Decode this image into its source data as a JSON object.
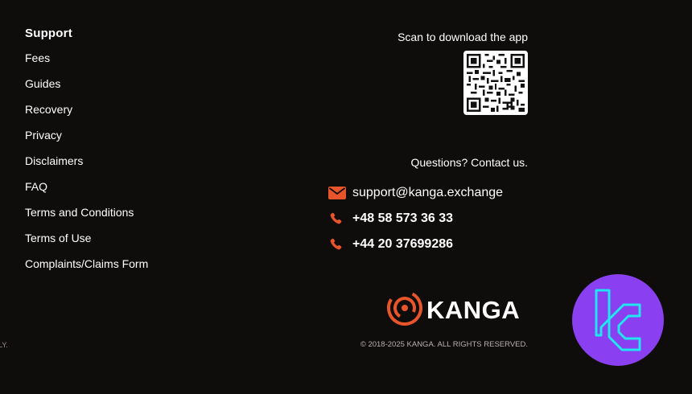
{
  "support": {
    "heading": "Support",
    "items": [
      {
        "label": "Fees"
      },
      {
        "label": "Guides"
      },
      {
        "label": "Recovery"
      },
      {
        "label": "Privacy"
      },
      {
        "label": "Disclaimers"
      },
      {
        "label": "FAQ"
      },
      {
        "label": "Terms and Conditions"
      },
      {
        "label": "Terms of Use"
      },
      {
        "label": "Complaints/Claims Form"
      }
    ]
  },
  "edge_fragment": "LY.",
  "app": {
    "scan_text": "Scan to download the app",
    "qr_icon": "qr-code-icon"
  },
  "contact": {
    "heading": "Questions? Contact us.",
    "email": "support@kanga.exchange",
    "phone_1": "+48 58 573 36 33",
    "phone_2": "+44 20 37699286",
    "email_icon": "envelope-icon",
    "phone_icon": "phone-icon"
  },
  "brand": {
    "name": "KANGA",
    "copyright": "© 2018-2025 KANGA. ALL RIGHTS RESERVED.",
    "logo_icon": "kanga-logo-icon"
  },
  "badge_icon": "tc-logo-badge-icon",
  "colors": {
    "background": "#0f0c0c",
    "accent": "#e8552a",
    "badge_purple": "#8a3ff0",
    "badge_cyan": "#1fe6f0"
  }
}
